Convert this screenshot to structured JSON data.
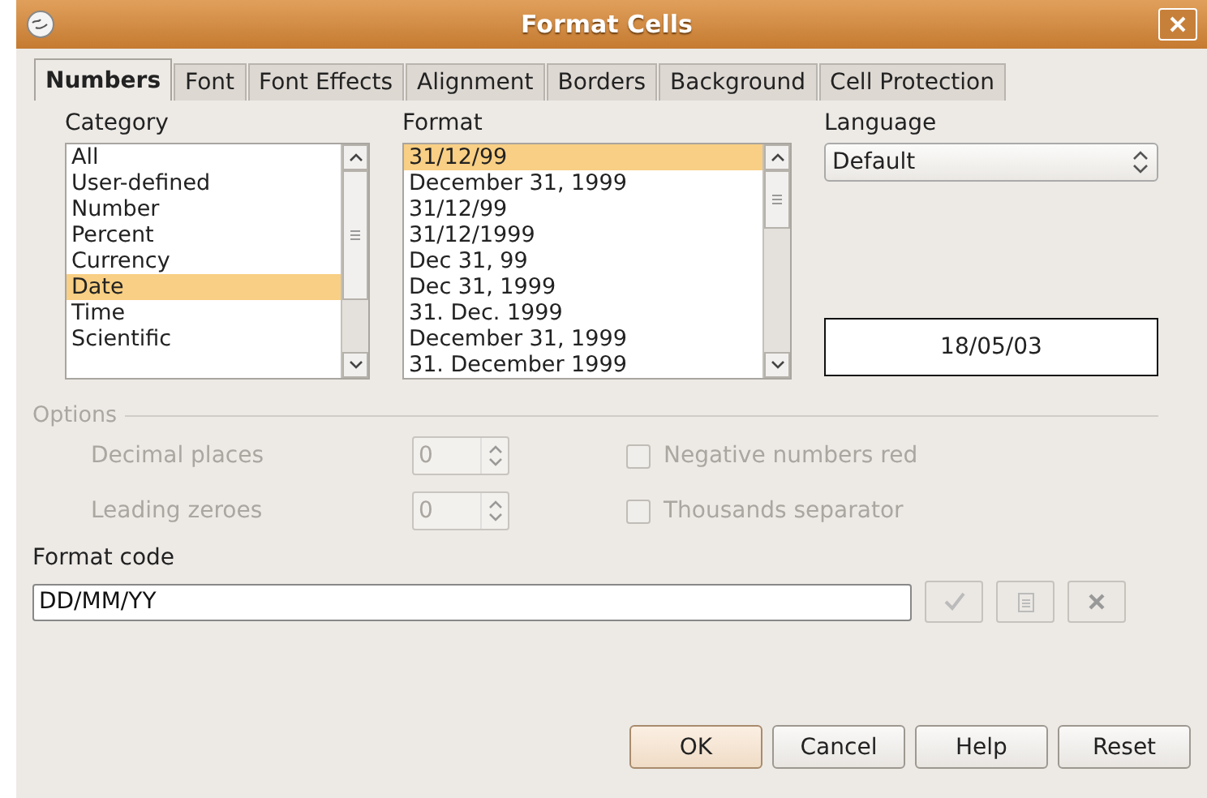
{
  "window": {
    "title": "Format Cells"
  },
  "tabs": [
    {
      "label": "Numbers",
      "selected": true
    },
    {
      "label": "Font",
      "selected": false
    },
    {
      "label": "Font Effects",
      "selected": false
    },
    {
      "label": "Alignment",
      "selected": false
    },
    {
      "label": "Borders",
      "selected": false
    },
    {
      "label": "Background",
      "selected": false
    },
    {
      "label": "Cell Protection",
      "selected": false
    }
  ],
  "category": {
    "label": "Category",
    "items": [
      {
        "label": "All",
        "selected": false
      },
      {
        "label": "User-defined",
        "selected": false
      },
      {
        "label": "Number",
        "selected": false
      },
      {
        "label": "Percent",
        "selected": false
      },
      {
        "label": "Currency",
        "selected": false
      },
      {
        "label": "Date",
        "selected": true
      },
      {
        "label": "Time",
        "selected": false
      },
      {
        "label": "Scientific",
        "selected": false
      }
    ]
  },
  "format": {
    "label": "Format",
    "items": [
      {
        "label": "31/12/99",
        "selected": true
      },
      {
        "label": "December 31, 1999",
        "selected": false
      },
      {
        "label": "31/12/99",
        "selected": false
      },
      {
        "label": "31/12/1999",
        "selected": false
      },
      {
        "label": "Dec 31, 99",
        "selected": false
      },
      {
        "label": "Dec 31, 1999",
        "selected": false
      },
      {
        "label": "31. Dec. 1999",
        "selected": false
      },
      {
        "label": "December 31, 1999",
        "selected": false
      },
      {
        "label": "31. December 1999",
        "selected": false
      }
    ]
  },
  "language": {
    "label": "Language",
    "value": "Default"
  },
  "preview": "18/05/03",
  "options": {
    "label": "Options",
    "disabled": true,
    "spinners": [
      {
        "label": "Decimal places",
        "value": "0"
      },
      {
        "label": "Leading zeroes",
        "value": "0"
      }
    ],
    "checkboxes": [
      {
        "label": "Negative numbers red",
        "checked": false
      },
      {
        "label": "Thousands separator",
        "checked": false
      }
    ]
  },
  "format_code": {
    "label": "Format code",
    "value": "DD/MM/YY"
  },
  "buttons": [
    {
      "label": "OK",
      "default": true
    },
    {
      "label": "Cancel",
      "default": false
    },
    {
      "label": "Help",
      "default": false
    },
    {
      "label": "Reset",
      "default": false
    }
  ]
}
